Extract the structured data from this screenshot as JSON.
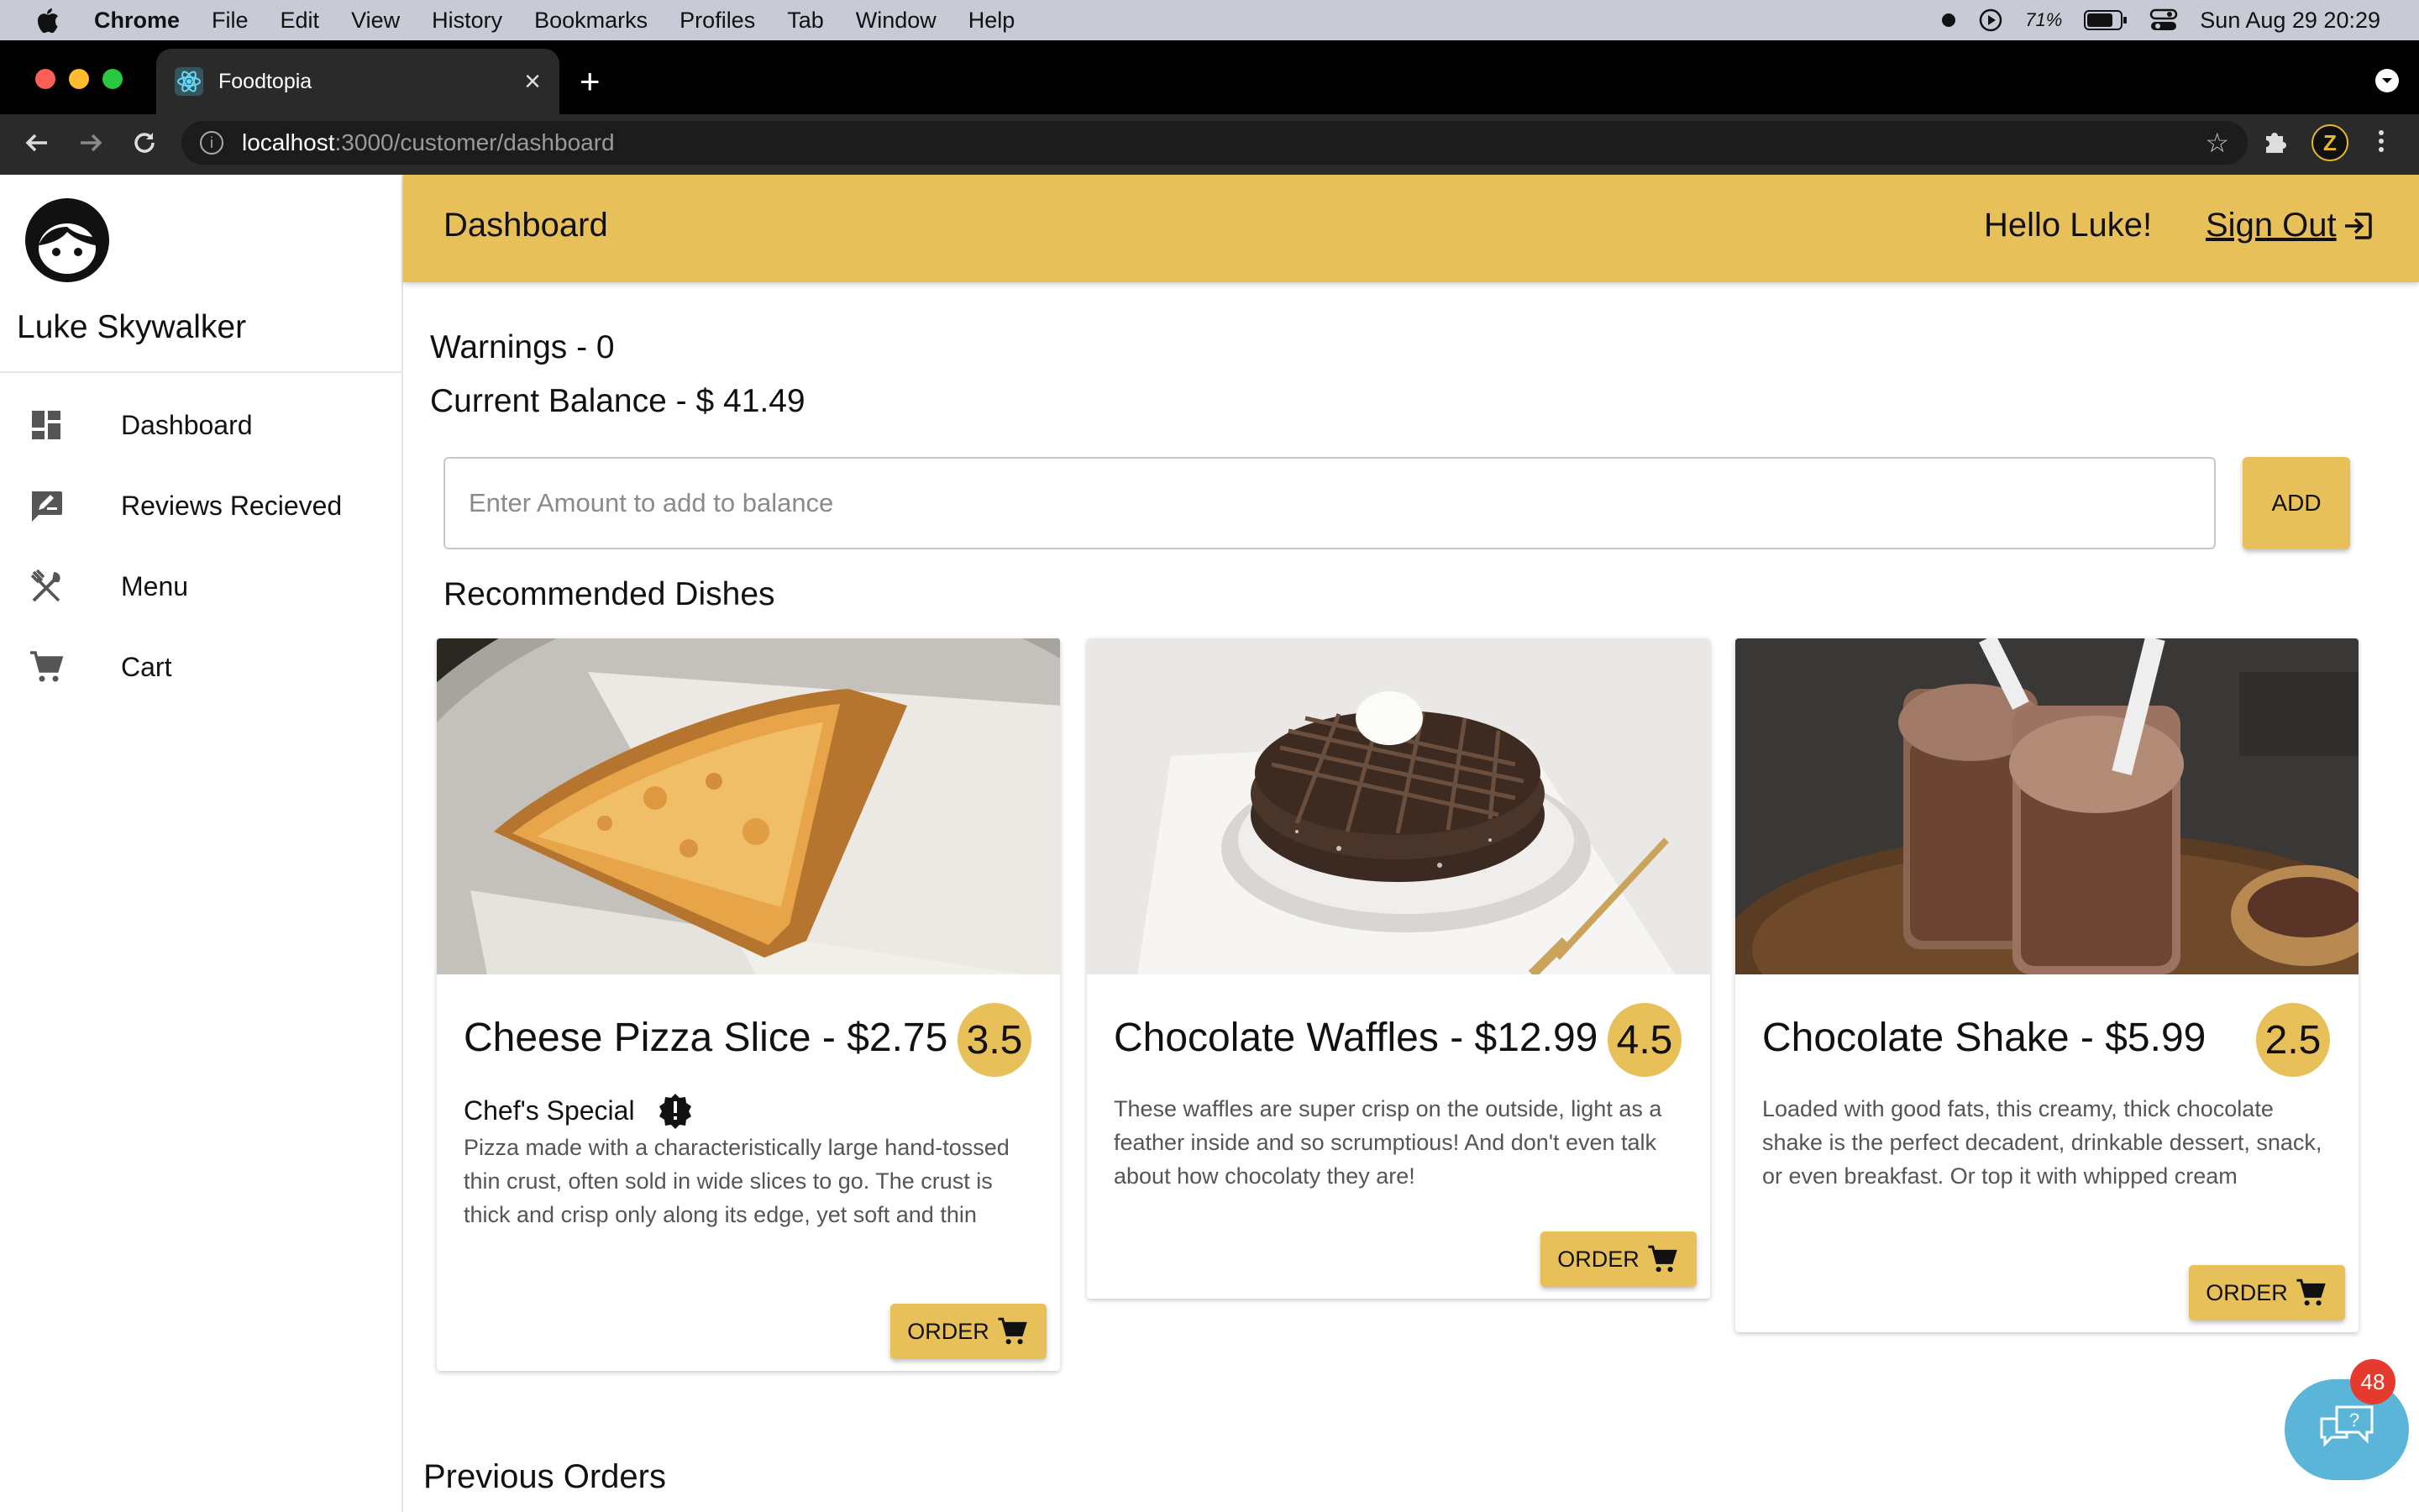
{
  "menubar": {
    "app": "Chrome",
    "items": [
      "File",
      "Edit",
      "View",
      "History",
      "Bookmarks",
      "Profiles",
      "Tab",
      "Window",
      "Help"
    ],
    "battery": "71%",
    "datetime": "Sun Aug 29  20:29"
  },
  "browser": {
    "tab_title": "Foodtopia",
    "url_host": "localhost",
    "url_path": ":3000/customer/dashboard",
    "tab_close": "×",
    "new_tab": "+"
  },
  "sidebar": {
    "user_name": "Luke Skywalker",
    "items": [
      {
        "label": "Dashboard",
        "icon": "dashboard-icon"
      },
      {
        "label": "Reviews Recieved",
        "icon": "rate-review-icon"
      },
      {
        "label": "Menu",
        "icon": "utensils-icon"
      },
      {
        "label": "Cart",
        "icon": "cart-icon"
      }
    ]
  },
  "header": {
    "title": "Dashboard",
    "greeting": "Hello Luke!",
    "signout": "Sign Out"
  },
  "account": {
    "warnings": "Warnings - 0",
    "balance": "Current Balance - $ 41.49",
    "amount_placeholder": "Enter Amount to add to balance",
    "add_label": "ADD"
  },
  "recommended": {
    "title": "Recommended Dishes",
    "dishes": [
      {
        "title": "Cheese Pizza Slice - $2.75",
        "rating": "3.5",
        "special": "Chef's Special",
        "description": "Pizza made with a characteristically large hand-tossed thin crust, often sold in wide slices to go. The crust is thick and crisp only along its edge, yet soft and thin",
        "order_label": "ORDER"
      },
      {
        "title": "Chocolate Waffles - $12.99",
        "rating": "4.5",
        "description": "These waffles are super crisp on the outside, light as a feather inside and so scrumptious! And don't even talk about how chocolaty they are!",
        "order_label": "ORDER"
      },
      {
        "title": "Chocolate Shake - $5.99",
        "rating": "2.5",
        "description": "Loaded with good fats, this creamy, thick chocolate shake is the perfect decadent, drinkable dessert, snack, or even breakfast. Or top it with whipped cream",
        "order_label": "ORDER"
      }
    ]
  },
  "previous_orders": {
    "title": "Previous Orders"
  },
  "chat": {
    "badge": "48"
  },
  "colors": {
    "accent": "#e8c05a",
    "chat": "#5bb5d8",
    "badge": "#e53b2f"
  }
}
